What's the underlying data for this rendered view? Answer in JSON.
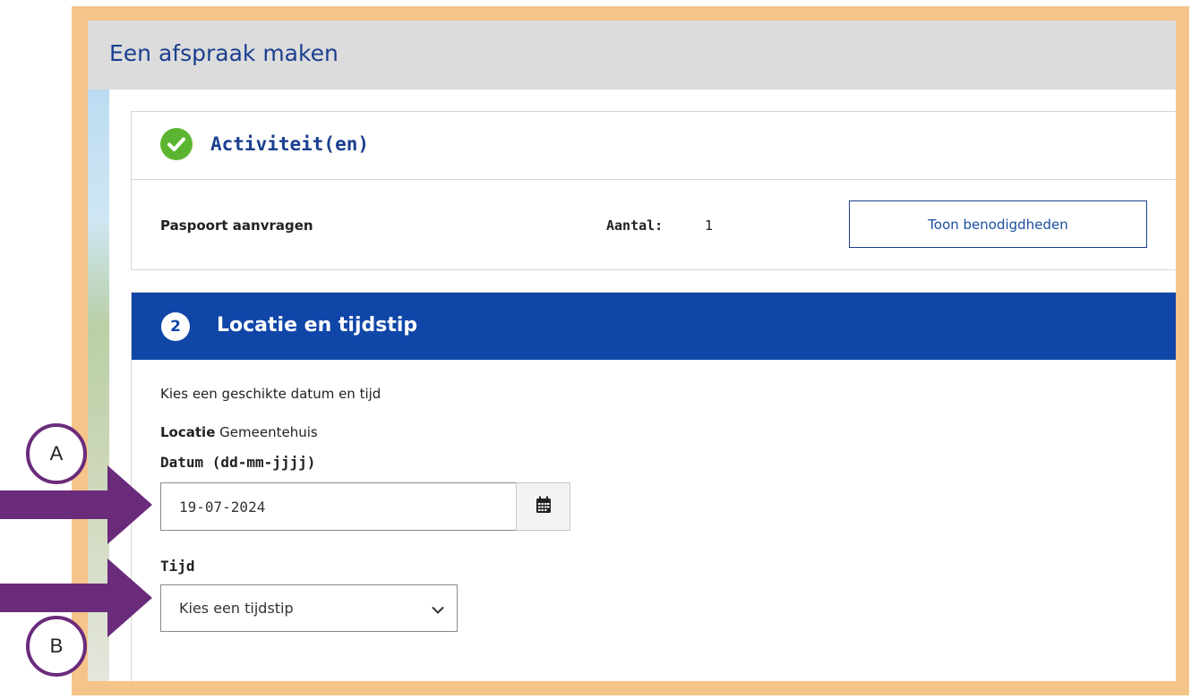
{
  "header": {
    "title": "Een afspraak maken"
  },
  "activities": {
    "title": "Activiteit(en)",
    "item": "Paspoort aanvragen",
    "count_label": "Aantal:",
    "count_value": "1",
    "button_label": "Toon benodigdheden"
  },
  "location_time": {
    "step_number": "2",
    "title": "Locatie en tijdstip",
    "intro": "Kies een geschikte datum en tijd",
    "location_label": "Locatie",
    "location_value": "Gemeentehuis",
    "date_label": "Datum (dd-mm-jjjj)",
    "date_value": "19-07-2024",
    "time_label": "Tijd",
    "time_selected": "Kies een tijdstip"
  },
  "annotations": {
    "a": "A",
    "b": "B"
  },
  "colors": {
    "frame": "#f5c48a",
    "header_bg": "#dcdcdc",
    "brand_blue": "#0f46a8",
    "check_green": "#5cb531",
    "annotation_purple": "#6b2b7b"
  },
  "icons": [
    "check-icon",
    "calendar-icon",
    "chevron-down-icon",
    "arrow-right-icon"
  ]
}
